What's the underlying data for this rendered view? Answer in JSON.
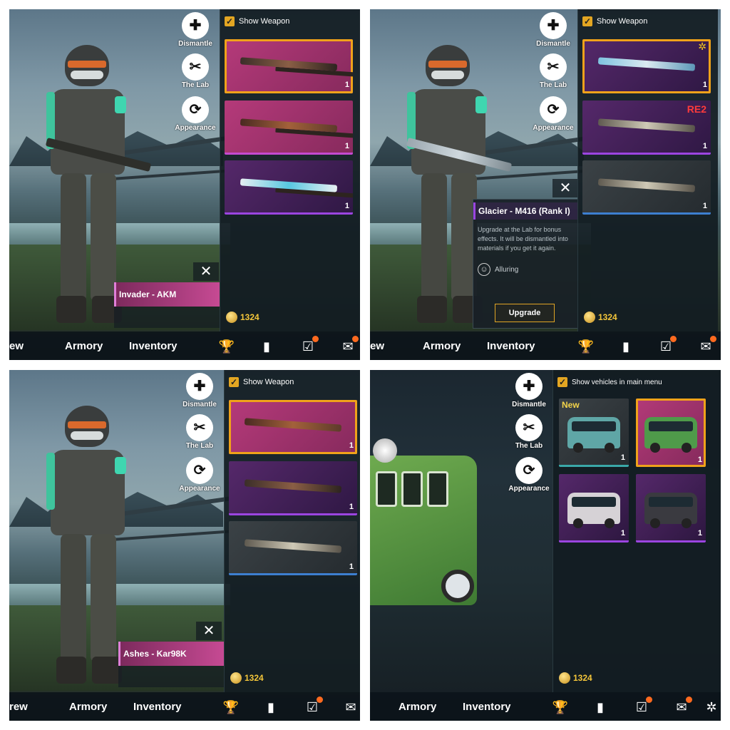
{
  "panels": {
    "p1": {
      "side_buttons": [
        {
          "label": "Dismantle",
          "icon": "puzzle-icon"
        },
        {
          "label": "The Lab",
          "icon": "lab-tools-icon"
        },
        {
          "label": "Appearance",
          "icon": "refresh-icon"
        }
      ],
      "show_label": "Show Weapon",
      "cards": [
        {
          "qty": "1",
          "rarity": "pink",
          "selected": true
        },
        {
          "qty": "1",
          "rarity": "pink"
        },
        {
          "qty": "1",
          "rarity": "purple"
        }
      ],
      "selected_name": "Invader - AKM",
      "coins": "1324",
      "nav": {
        "left_partial": "ew",
        "armory": "Armory",
        "inventory": "Inventory"
      }
    },
    "p2": {
      "side_buttons": [
        {
          "label": "Dismantle",
          "icon": "puzzle-icon"
        },
        {
          "label": "The Lab",
          "icon": "lab-tools-icon"
        },
        {
          "label": "Appearance",
          "icon": "refresh-icon"
        }
      ],
      "show_label": "Show Weapon",
      "cards": [
        {
          "qty": "1",
          "rarity": "purple",
          "selected": true
        },
        {
          "qty": "1",
          "rarity": "purple",
          "badge": "RE2"
        },
        {
          "qty": "1",
          "rarity": "grey"
        }
      ],
      "popup": {
        "title": "Glacier - M416 (Rank I)",
        "desc": "Upgrade at the Lab for bonus effects. It will be dismantled into materials if you get it again.",
        "trait": "Alluring",
        "button": "Upgrade"
      },
      "coins": "1324",
      "nav": {
        "left_partial": "ew",
        "armory": "Armory",
        "inventory": "Inventory"
      }
    },
    "p3": {
      "side_buttons": [
        {
          "label": "Dismantle",
          "icon": "puzzle-icon"
        },
        {
          "label": "The Lab",
          "icon": "lab-tools-icon"
        },
        {
          "label": "Appearance",
          "icon": "refresh-icon"
        }
      ],
      "show_label": "Show Weapon",
      "cards": [
        {
          "qty": "1",
          "rarity": "pink",
          "selected": true
        },
        {
          "qty": "1",
          "rarity": "purple"
        },
        {
          "qty": "1",
          "rarity": "grey"
        }
      ],
      "selected_name": "Ashes - Kar98K",
      "coins": "1324",
      "nav": {
        "left_partial": "rew",
        "armory": "Armory",
        "inventory": "Inventory"
      }
    },
    "p4": {
      "side_buttons": [
        {
          "label": "Dismantle",
          "icon": "puzzle-icon"
        },
        {
          "label": "The Lab",
          "icon": "lab-tools-icon"
        },
        {
          "label": "Appearance",
          "icon": "refresh-icon"
        }
      ],
      "show_label": "Show vehicles in main menu",
      "vehicles": [
        {
          "qty": "1",
          "new": "New"
        },
        {
          "qty": "1"
        },
        {
          "qty": "1"
        },
        {
          "qty": "1"
        }
      ],
      "coins": "1324",
      "nav": {
        "armory": "Armory",
        "inventory": "Inventory"
      }
    }
  },
  "colors": {
    "accent": "#f0a21a",
    "coin": "#f4c63a",
    "notify": "#ff6a1f"
  }
}
